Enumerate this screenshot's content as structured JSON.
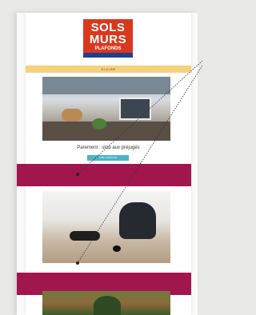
{
  "logo": {
    "line1": "SOLS",
    "line2": "MURS",
    "line3": "PLAFONDS"
  },
  "banner": {
    "text": "À LA UNE"
  },
  "article1": {
    "caption": "Parement : stop aux préjugés",
    "cta_label": "LIRE L'ARTICLE"
  },
  "colors": {
    "logo_red": "#d9381e",
    "logo_blue": "#1f3f8f",
    "banner": "#f6d17a",
    "cta": "#48b6c8",
    "bar": "#a2164e"
  }
}
